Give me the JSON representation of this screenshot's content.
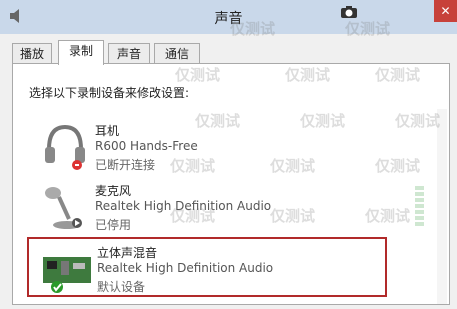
{
  "window": {
    "title": "声音",
    "close_label": "✕"
  },
  "tabs": [
    {
      "label": "播放"
    },
    {
      "label": "录制"
    },
    {
      "label": "声音"
    },
    {
      "label": "通信"
    }
  ],
  "instruction": "选择以下录制设备来修改设置:",
  "devices": [
    {
      "name": "耳机",
      "description": "R600 Hands-Free",
      "status": "已断开连接",
      "icon": "headset-icon"
    },
    {
      "name": "麦克风",
      "description": "Realtek High Definition Audio",
      "status": "已停用",
      "icon": "microphone-icon"
    },
    {
      "name": "立体声混音",
      "description": "Realtek High Definition Audio",
      "status": "默认设备",
      "icon": "sound-card-icon"
    }
  ],
  "watermark": "仅测试",
  "colors": {
    "titlebar": "#c9d8ea",
    "selection_border": "#b12a2a",
    "close": "#c7413a"
  }
}
